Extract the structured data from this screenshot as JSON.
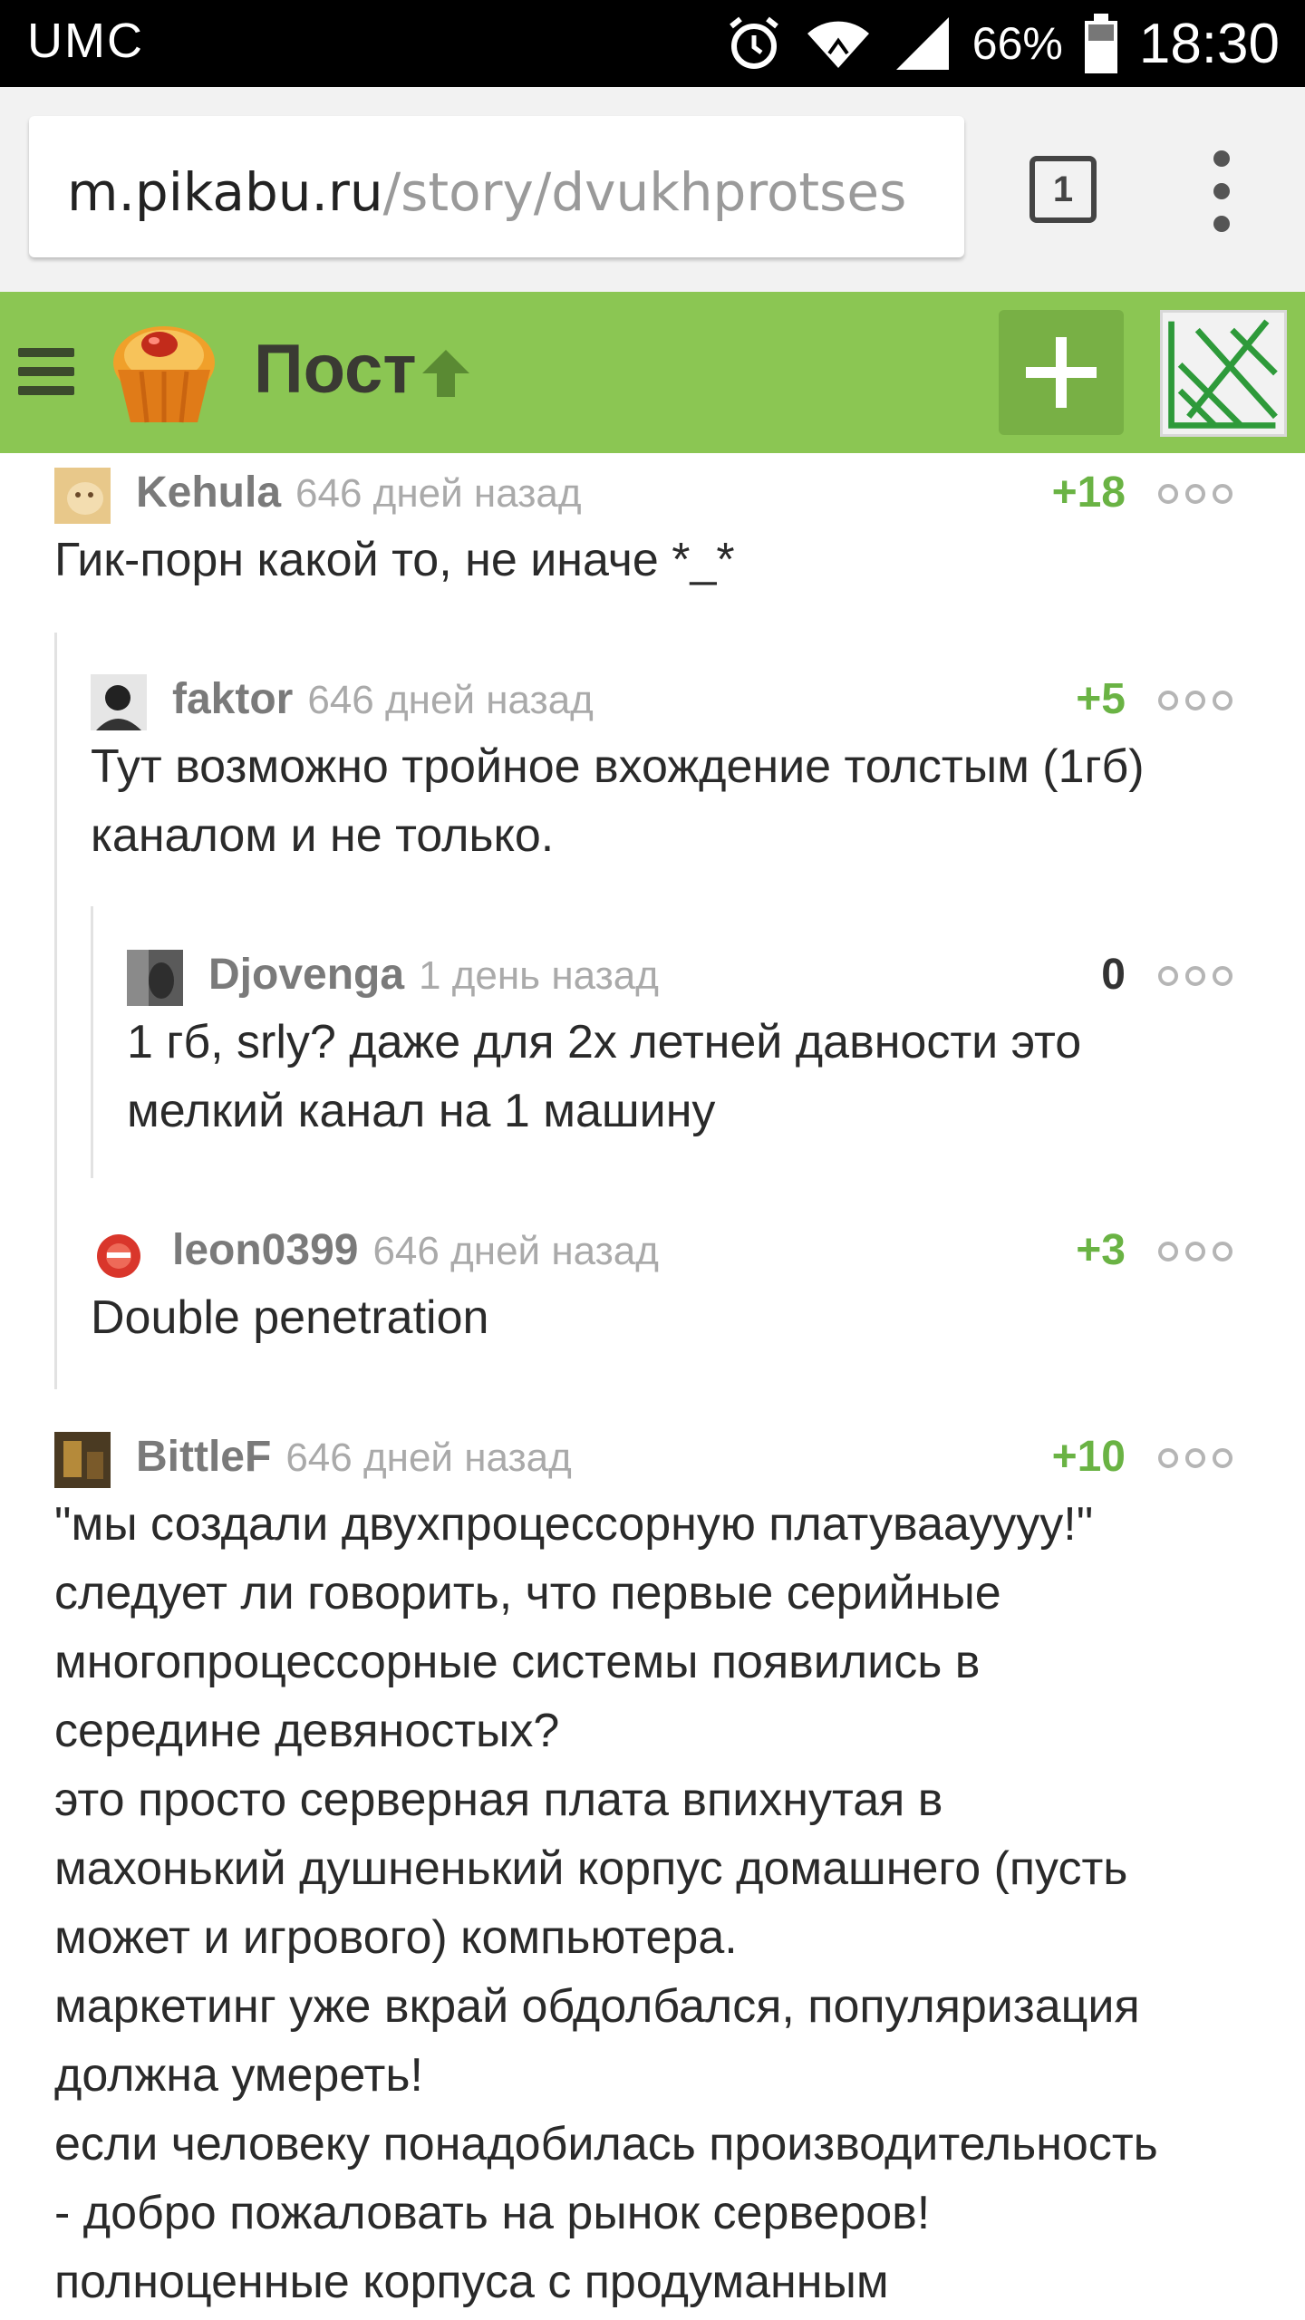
{
  "status_bar": {
    "carrier": "UMC",
    "battery_percent": "66%",
    "time": "18:30",
    "icons": [
      "alarm-icon",
      "wifi-icon",
      "signal-icon",
      "battery-icon"
    ]
  },
  "browser": {
    "url_domain": "m.pikabu.ru",
    "url_path": "/story/dvukhprotses",
    "tab_count": "1",
    "menu_icon": "overflow-menu-icon"
  },
  "header": {
    "title": "Пост",
    "logo_icon": "cupcake-logo-icon",
    "arrow_icon": "up-arrow-icon",
    "add_icon": "plus-icon",
    "colors": {
      "bar": "#8bc653",
      "button": "#78b045",
      "positive_score": "#6ab344"
    }
  },
  "comments": [
    {
      "user": "Kehula",
      "time": "646 дней назад",
      "score": "+18",
      "text": "Гик-порн какой то, не иначе *_*"
    },
    {
      "user": "faktor",
      "time": "646 дней назад",
      "score": "+5",
      "text": "Тут возможно тройное вхождение толстым (1гб)\nканалом и не только."
    },
    {
      "user": "Djovenga",
      "time": "1 день назад",
      "score": "0",
      "text": "1 гб, srly? даже для 2х летней давности это\nмелкий канал на 1 машину"
    },
    {
      "user": "leon0399",
      "time": "646 дней назад",
      "score": "+3",
      "text": "Double penetration"
    },
    {
      "user": "BittleF",
      "time": "646 дней назад",
      "score": "+10",
      "text": "\"мы создали двухпроцессорную платуваауууу!\"\nследует ли говорить, что первые серийные\nмногопроцессорные системы появились в\nсередине девяностых?\nэто просто серверная плата впихнутая в\nмахонький душненький корпус домашнего (пусть\nможет и игрового) компьютера.\nмаркетинг уже вкрай обдолбался, популяризация\nдолжна умереть!\nесли человеку понадобилась производительность\n- добро пожаловать на рынок серверов!\nполноценные корпуса с продуманным"
    }
  ]
}
